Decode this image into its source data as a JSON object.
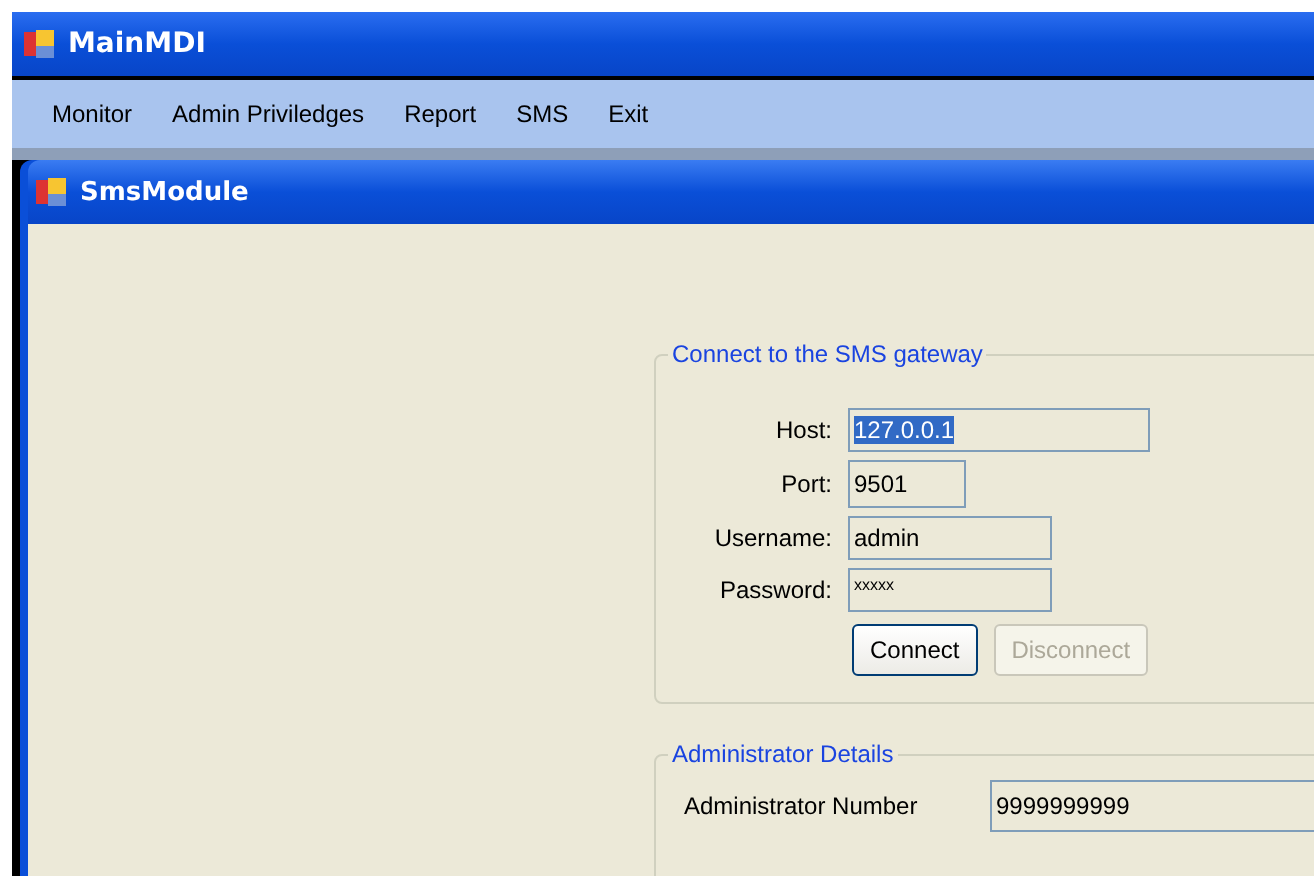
{
  "window": {
    "title": "MainMDI"
  },
  "menu": [
    {
      "label": "Monitor"
    },
    {
      "label": "Admin Priviledges"
    },
    {
      "label": "Report"
    },
    {
      "label": "SMS"
    },
    {
      "label": "Exit"
    }
  ],
  "child_window": {
    "title": "SmsModule"
  },
  "gateway_group": {
    "title": "Connect to the SMS gateway",
    "fields": [
      {
        "label": "Host:",
        "value": "127.0.0.1",
        "highlighted": true,
        "kind": "wide"
      },
      {
        "label": "Port:",
        "value": "9501",
        "highlighted": false,
        "kind": "short"
      },
      {
        "label": "Username:",
        "value": "admin",
        "highlighted": false,
        "kind": "medium"
      },
      {
        "label": "Password:",
        "value": "xxxxx",
        "highlighted": false,
        "kind": "password"
      }
    ],
    "buttons": [
      {
        "label": "Connect",
        "disabled": false
      },
      {
        "label": "Disconnect",
        "disabled": true
      }
    ]
  },
  "admin_group": {
    "title": "Administrator Details",
    "label": "Administrator Number",
    "value": "9999999999"
  }
}
